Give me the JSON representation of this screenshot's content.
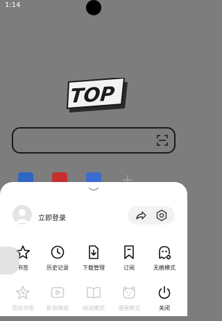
{
  "status": {
    "time": "1:14"
  },
  "logo": {
    "text": "TOP"
  },
  "shortcuts": [
    {
      "icon": "app-icon-blue",
      "color": "#2f66c4"
    },
    {
      "icon": "app-icon-red",
      "color": "#c4302f"
    },
    {
      "icon": "app-icon-blue-2",
      "color": "#3c6cd0"
    },
    {
      "icon": "add-icon",
      "color": "#9a9a9a"
    }
  ],
  "account": {
    "login_label": "立即登录"
  },
  "menu_row1": [
    {
      "label": "书签",
      "icon": "star-icon"
    },
    {
      "label": "历史记录",
      "icon": "clock-icon"
    },
    {
      "label": "下载管理",
      "icon": "download-icon"
    },
    {
      "label": "订阅",
      "icon": "bookmark-icon"
    },
    {
      "label": "无痕模式",
      "icon": "ghost-icon"
    }
  ],
  "menu_row2": [
    {
      "label": "添加书签",
      "icon": "star-plus-icon",
      "enabled": false
    },
    {
      "label": "影音嗅探",
      "icon": "video-sniff-icon",
      "enabled": false
    },
    {
      "label": "阅读模式",
      "icon": "book-icon",
      "enabled": false
    },
    {
      "label": "漫画模式",
      "icon": "comic-icon",
      "enabled": false
    },
    {
      "label": "关闭",
      "icon": "power-icon",
      "enabled": true
    }
  ],
  "colors": {
    "overlay": "#7d7d7d",
    "sheet": "#ffffff",
    "text": "#222222",
    "disabled": "#c7c7c7"
  }
}
